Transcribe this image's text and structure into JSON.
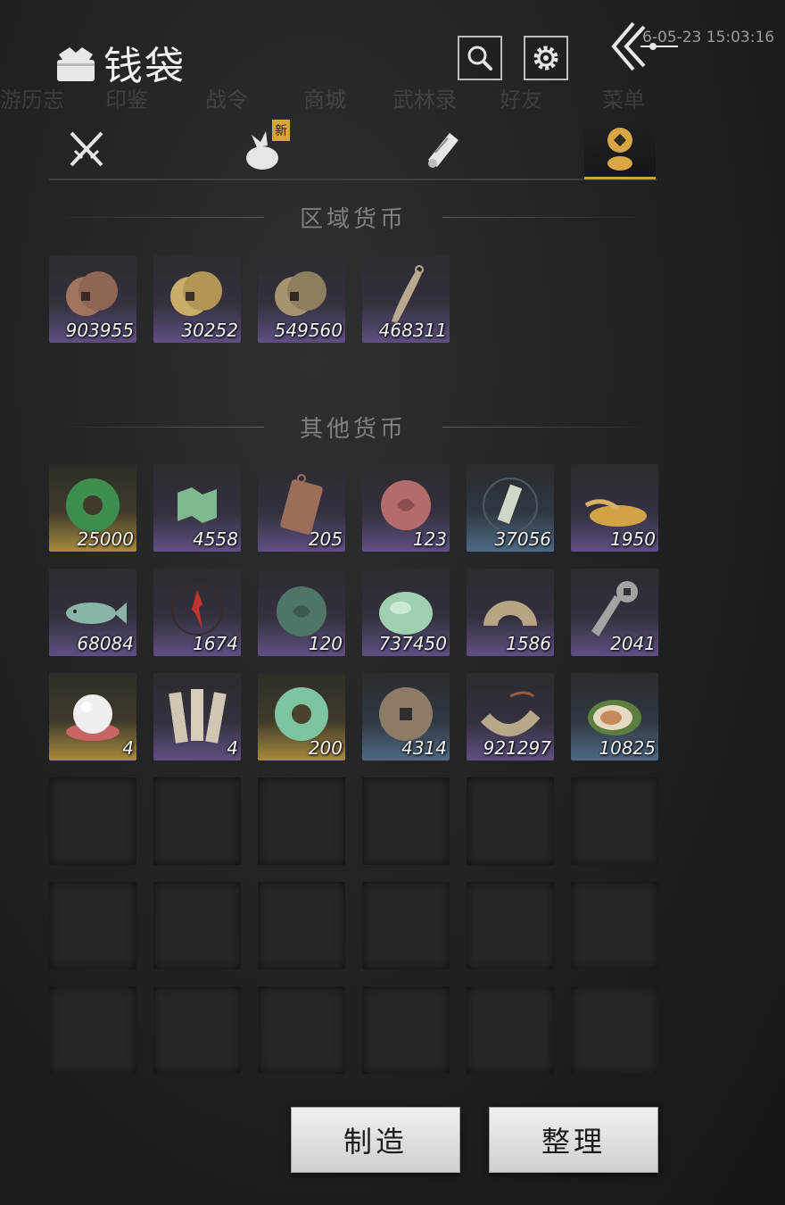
{
  "header": {
    "title": "钱袋",
    "timestamp": "6-05-23 15:03:16",
    "bg_labels": [
      "游历志",
      "印鉴",
      "战令",
      "商城",
      "武林录",
      "好友",
      "菜单"
    ]
  },
  "tabs": [
    {
      "icon": "crossed-swords-icon"
    },
    {
      "icon": "bundle-icon",
      "badge": "新"
    },
    {
      "icon": "scroll-icon"
    },
    {
      "icon": "coin-stack-icon",
      "active": true
    }
  ],
  "sections": {
    "regional": "区域货币",
    "other": "其他货币"
  },
  "regional_items": [
    {
      "icon": "copper-coins-icon",
      "count": "903955",
      "rarity": "purple"
    },
    {
      "icon": "gold-coins-icon",
      "count": "30252",
      "rarity": "purple"
    },
    {
      "icon": "bronze-coins-icon",
      "count": "549560",
      "rarity": "purple"
    },
    {
      "icon": "knife-money-icon",
      "count": "468311",
      "rarity": "purple"
    }
  ],
  "other_items": [
    {
      "icon": "jade-ring-green-icon",
      "count": "25000",
      "rarity": "gold"
    },
    {
      "icon": "map-fragment-icon",
      "count": "4558",
      "rarity": "purple"
    },
    {
      "icon": "copper-token-icon",
      "count": "205",
      "rarity": "purple"
    },
    {
      "icon": "red-jade-icon",
      "count": "123",
      "rarity": "purple"
    },
    {
      "icon": "tablet-icon",
      "count": "37056",
      "rarity": "blue"
    },
    {
      "icon": "grain-pile-icon",
      "count": "1950",
      "rarity": "purple"
    },
    {
      "icon": "fish-icon",
      "count": "68084",
      "rarity": "purple"
    },
    {
      "icon": "red-rune-icon",
      "count": "1674",
      "rarity": "purple"
    },
    {
      "icon": "dark-jade-icon",
      "count": "120",
      "rarity": "purple"
    },
    {
      "icon": "jade-stone-icon",
      "count": "737450",
      "rarity": "purple"
    },
    {
      "icon": "bridge-coin-icon",
      "count": "1586",
      "rarity": "purple"
    },
    {
      "icon": "key-coin-icon",
      "count": "2041",
      "rarity": "purple"
    },
    {
      "icon": "pearl-icon",
      "count": "4",
      "rarity": "gold"
    },
    {
      "icon": "paper-slips-icon",
      "count": "4",
      "rarity": "purple"
    },
    {
      "icon": "jade-ring-light-icon",
      "count": "200",
      "rarity": "gold"
    },
    {
      "icon": "ancient-coin-icon",
      "count": "4314",
      "rarity": "blue"
    },
    {
      "icon": "coin-string-icon",
      "count": "921297",
      "rarity": "purple"
    },
    {
      "icon": "melon-icon",
      "count": "10825",
      "rarity": "blue"
    }
  ],
  "empty_slots": 18,
  "buttons": {
    "craft": "制造",
    "sort": "整理"
  }
}
